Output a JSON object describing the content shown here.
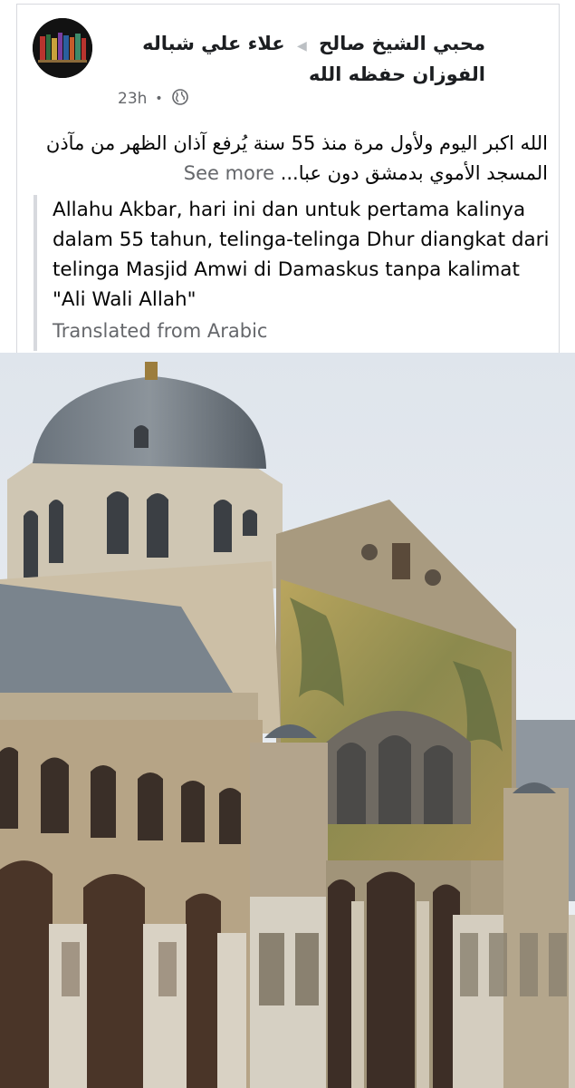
{
  "post": {
    "author": "محبي الشيخ صالح",
    "group": "علاء علي شباله الفوزان حفظه الله",
    "time": "23h",
    "privacy_icon": "globe-icon",
    "text": "الله اكبر اليوم ولأول مرة منذ 55 سنة يُرفع آذان الظهر من مآذن المسجد الأموي بدمشق دون عبا...",
    "see_more": "See more",
    "translation": "Allahu Akbar, hari ini dan untuk pertama kalinya dalam 55 tahun, telinga-telinga Dhur diangkat dari telinga Masjid Amwi di Damaskus tanpa kalimat \"Ali Wali Allah\"",
    "translated_label": "Translated from Arabic"
  },
  "colors": {
    "meta_text": "#65676b",
    "card_border": "#d7d9de",
    "text": "#050505"
  }
}
